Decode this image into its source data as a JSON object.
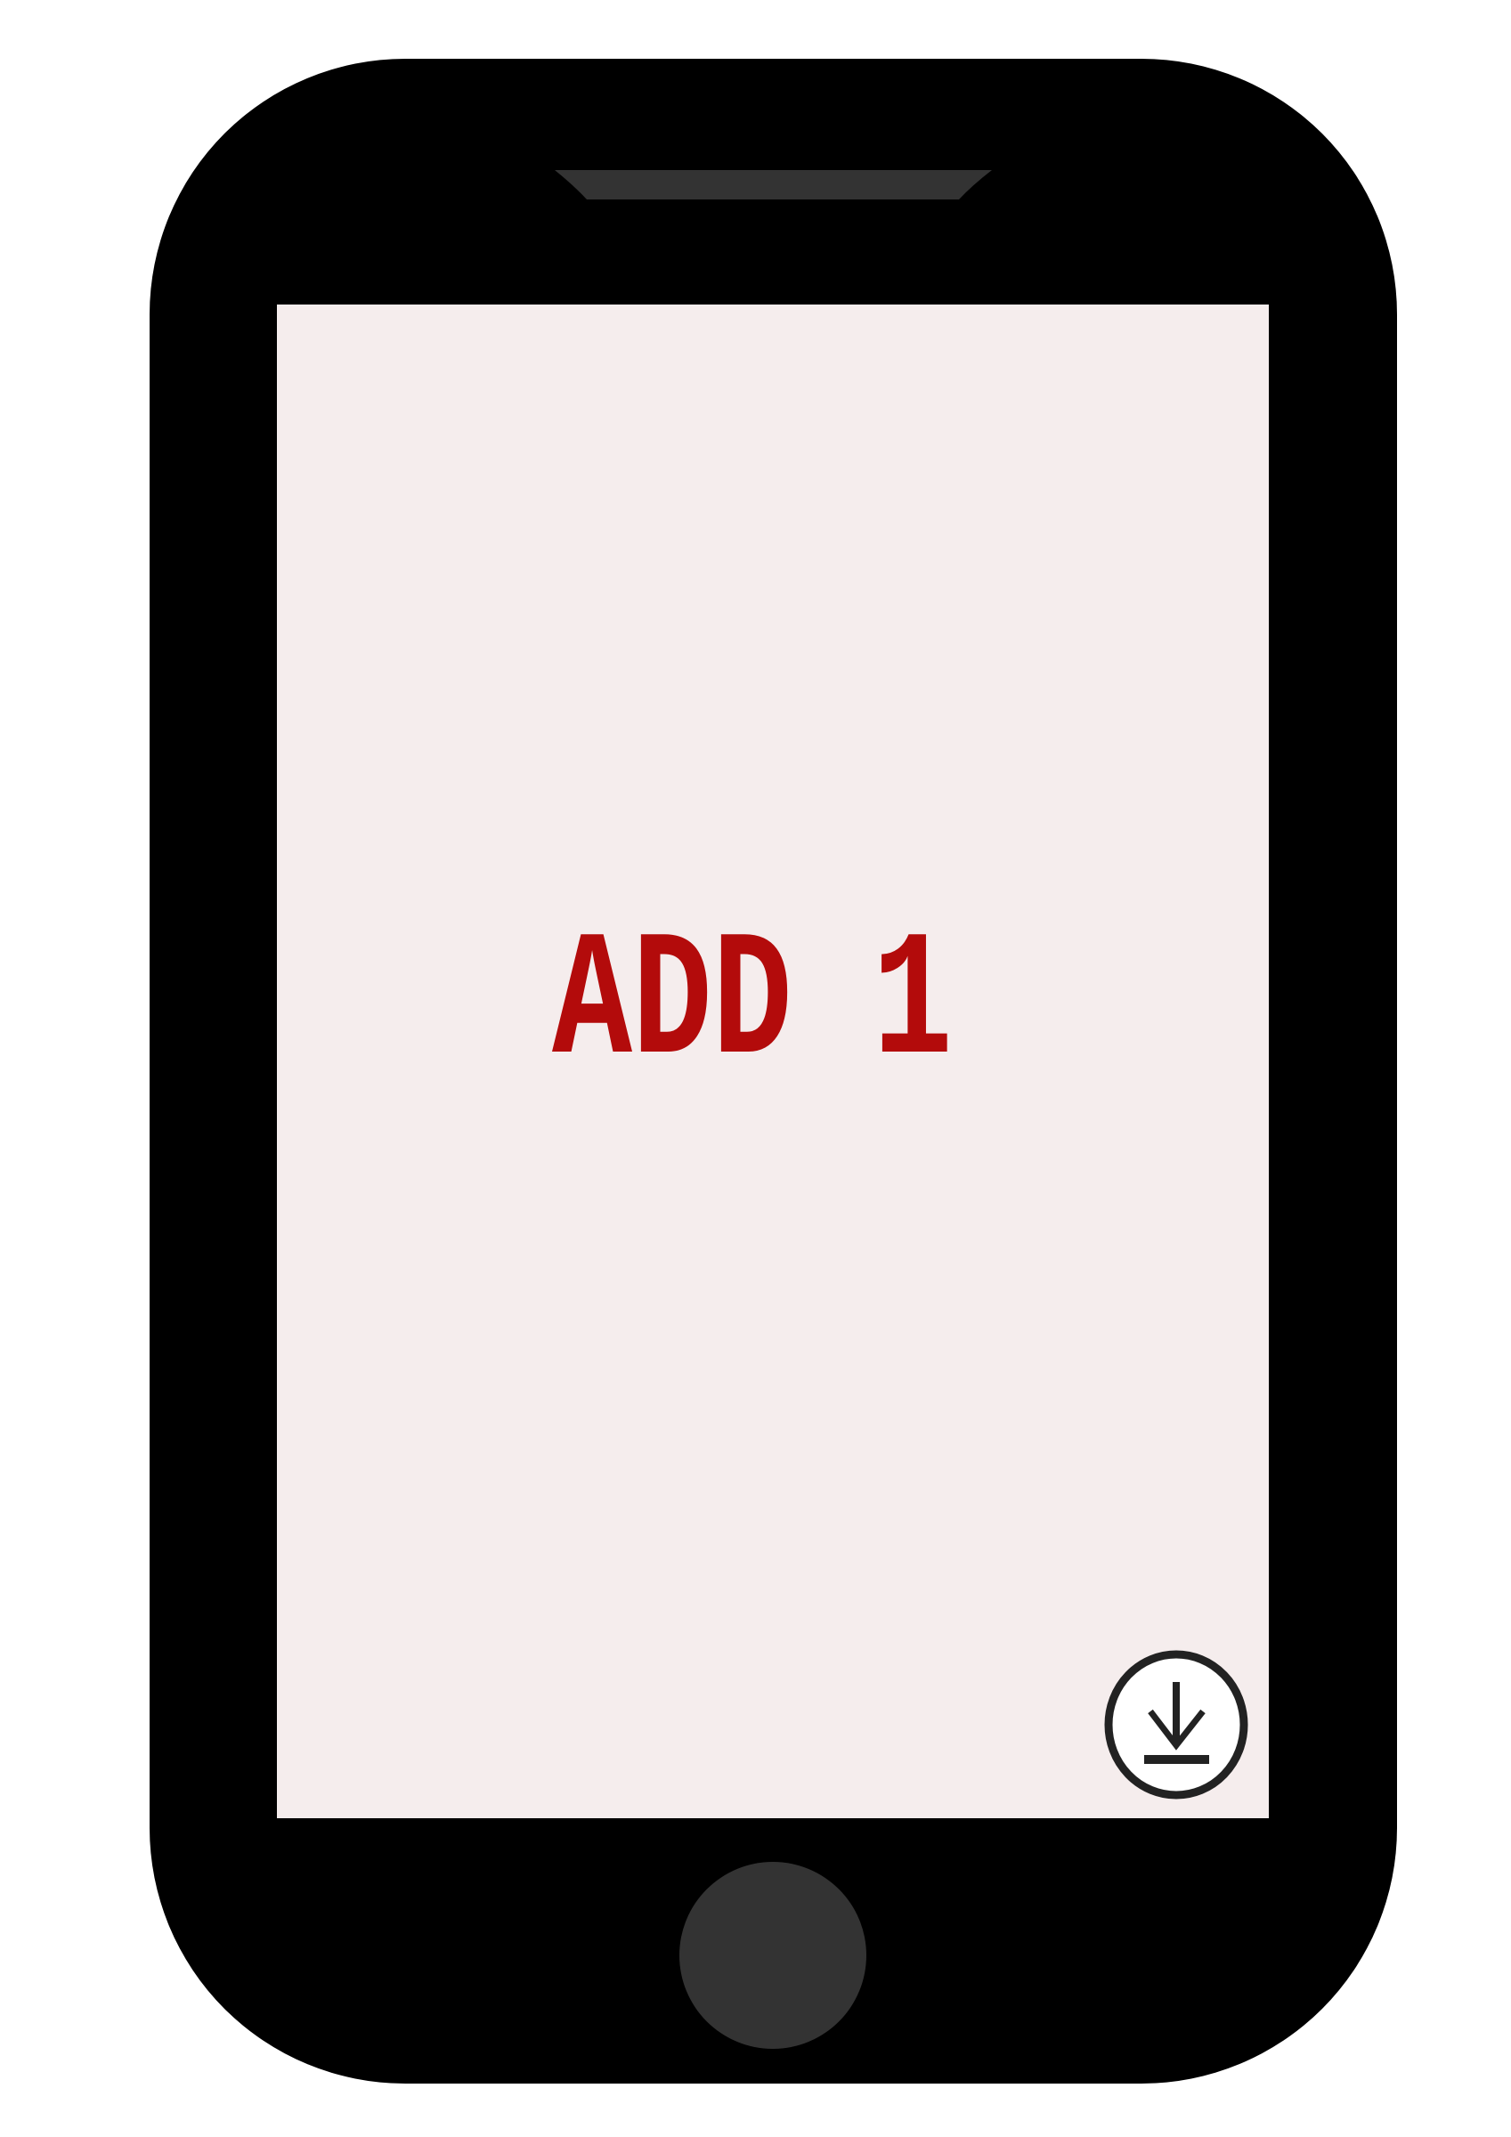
{
  "screen": {
    "ad_label": "ADD 1"
  },
  "icons": {
    "download": "download-icon",
    "home": "home-button",
    "speaker": "speaker-grille"
  },
  "colors": {
    "page_background": "#ffffff",
    "phone_body": "#000000",
    "speaker": "#333333",
    "screen": "#f5eded",
    "ad_text": "#b30b0b",
    "download_stroke": "#222222",
    "download_fill": "#ffffff",
    "home_button": "#333333"
  }
}
